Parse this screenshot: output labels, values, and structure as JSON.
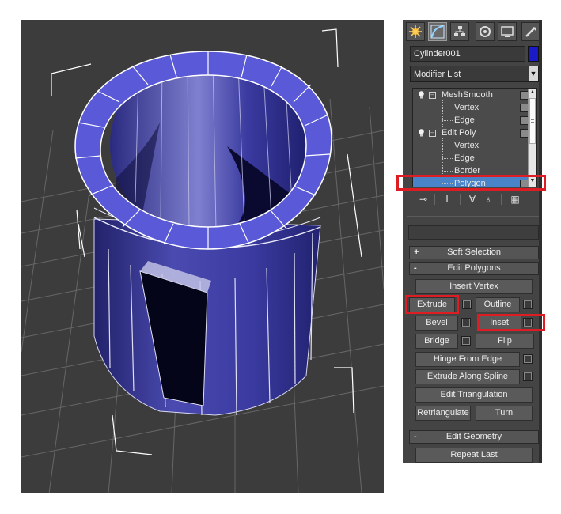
{
  "object_name": "Cylinder001",
  "object_color": "#1a1ac8",
  "modifier_list": "Modifier List",
  "stack": [
    {
      "label": "MeshSmooth",
      "level": 0
    },
    {
      "label": "Vertex",
      "level": 1
    },
    {
      "label": "Edge",
      "level": 1
    },
    {
      "label": "Edit Poly",
      "level": 0
    },
    {
      "label": "Vertex",
      "level": 1
    },
    {
      "label": "Edge",
      "level": 1
    },
    {
      "label": "Border",
      "level": 1
    },
    {
      "label": "Polygon",
      "level": 1,
      "selected": true
    }
  ],
  "tabs": [
    "create-icon",
    "modify-icon",
    "hierarchy-icon",
    "motion-icon",
    "display-icon",
    "utilities-icon"
  ],
  "rollouts": {
    "soft_selection": {
      "sign": "+",
      "label": "Soft Selection"
    },
    "edit_polygons": {
      "sign": "-",
      "label": "Edit Polygons"
    },
    "edit_geometry": {
      "sign": "-",
      "label": "Edit Geometry"
    }
  },
  "buttons": {
    "insert_vertex": "Insert Vertex",
    "extrude": "Extrude",
    "outline": "Outline",
    "bevel": "Bevel",
    "inset": "Inset",
    "bridge": "Bridge",
    "flip": "Flip",
    "hinge_from_edge": "Hinge From Edge",
    "extrude_along_spline": "Extrude Along Spline",
    "edit_triangulation": "Edit Triangulation",
    "retriangulate": "Retriangulate",
    "turn": "Turn",
    "repeat_last": "Repeat Last"
  },
  "colors": {
    "highlight": "#dd1c24",
    "rim": "#5a5ad8",
    "body": "#3b3b9c",
    "selection": "#4a84c8"
  }
}
